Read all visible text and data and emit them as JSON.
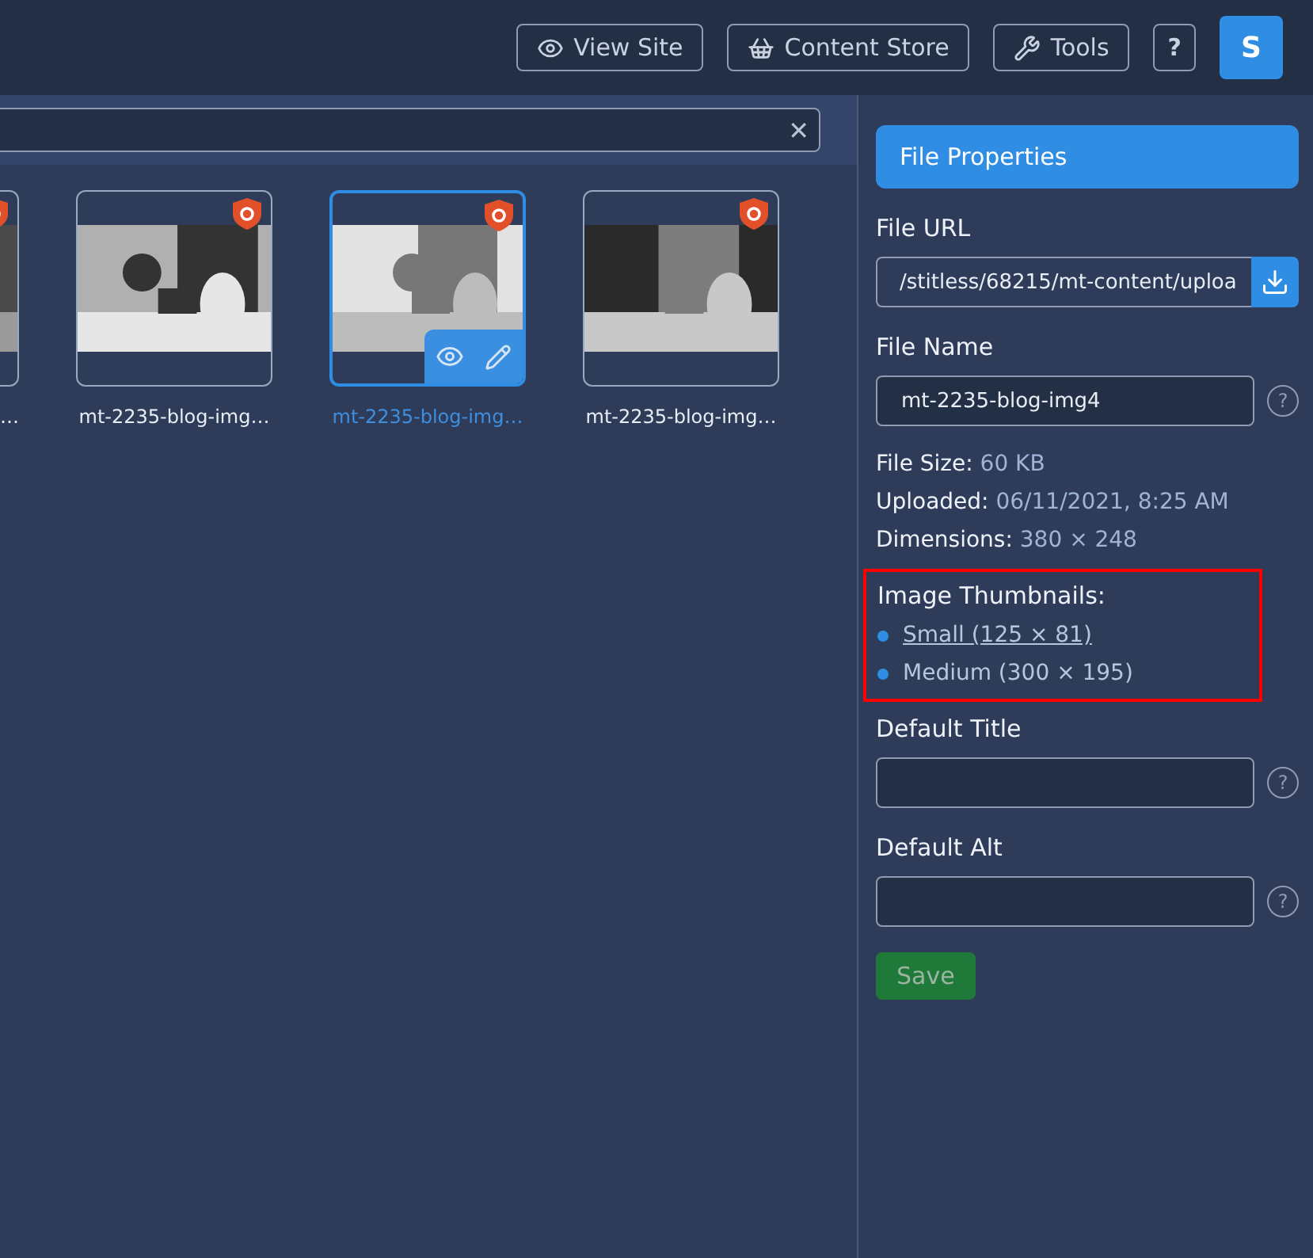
{
  "topbar": {
    "buttons": [
      {
        "label": "View Site",
        "kind": "eye"
      },
      {
        "label": "Content Store",
        "kind": "basket"
      },
      {
        "label": "Tools",
        "kind": "wrench"
      }
    ],
    "help": "?",
    "avatar": "S"
  },
  "search": {
    "clear": "✕"
  },
  "files": [
    {
      "name": "…",
      "selected": false,
      "cut": true
    },
    {
      "name": "mt-2235-blog-img…",
      "selected": false,
      "cut": false
    },
    {
      "name": "mt-2235-blog-img…",
      "selected": true,
      "cut": false
    },
    {
      "name": "mt-2235-blog-img…",
      "selected": false,
      "cut": false
    }
  ],
  "panel": {
    "title": "File Properties",
    "url": {
      "label": "File URL",
      "value": "/stitless/68215/mt-content/uploa"
    },
    "file_name": {
      "label": "File Name",
      "value": "mt-2235-blog-img4",
      "help": "?"
    },
    "info": [
      {
        "label": "File Size:",
        "value": "60 KB"
      },
      {
        "label": "Uploaded:",
        "value": "06/11/2021, 8:25 AM"
      },
      {
        "label": "Dimensions:",
        "value": "380 × 248"
      }
    ],
    "thumbnails": {
      "label": "Image Thumbnails:",
      "highlighted": true,
      "items": [
        {
          "text": "Small (125 × 81)",
          "link": true
        },
        {
          "text": "Medium (300 × 195)",
          "link": false
        }
      ]
    },
    "default_title": {
      "label": "Default Title",
      "help": "?"
    },
    "default_alt": {
      "label": "Default Alt",
      "help": "?"
    },
    "save": {
      "label": "Save",
      "disabled": true
    }
  }
}
